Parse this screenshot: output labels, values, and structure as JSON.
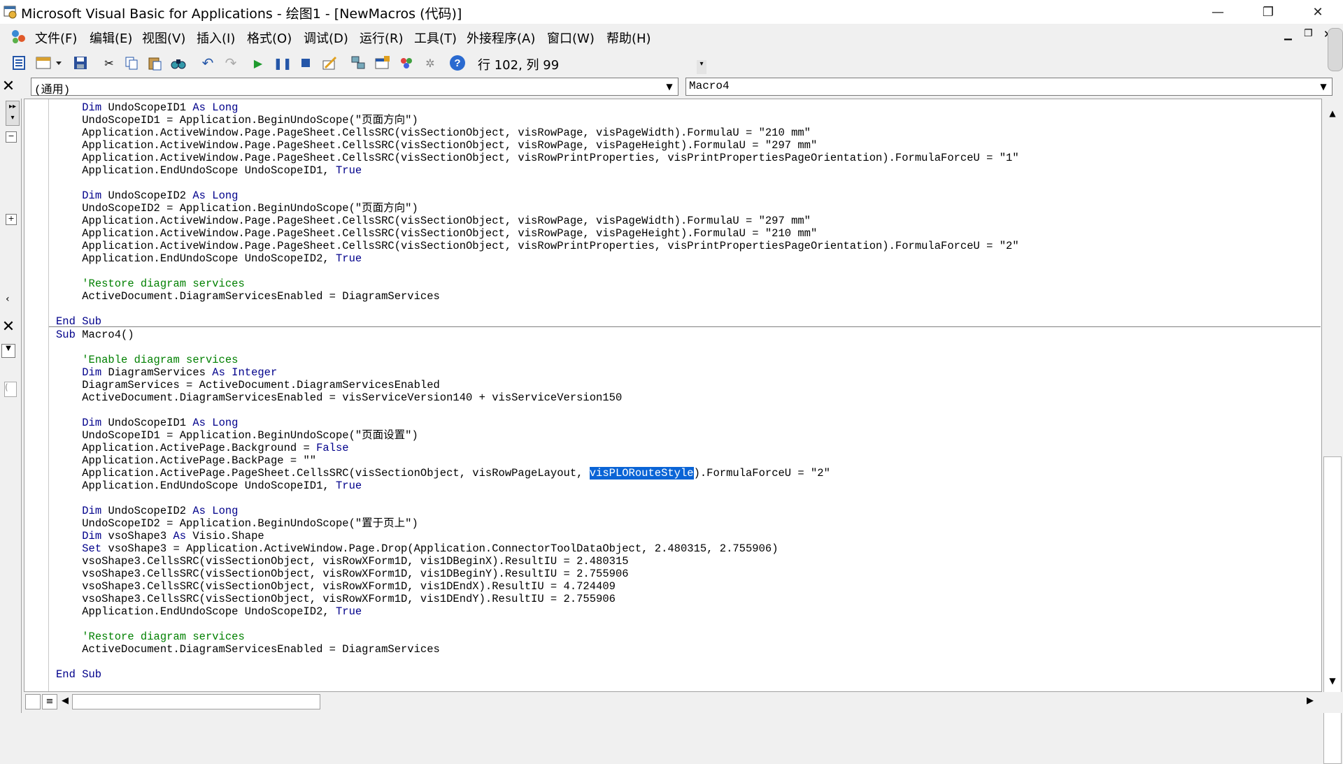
{
  "window": {
    "title": "Microsoft Visual Basic for Applications - 绘图1 - [NewMacros (代码)]"
  },
  "menu": [
    "文件(F)",
    "编辑(E)",
    "视图(V)",
    "插入(I)",
    "格式(O)",
    "调试(D)",
    "运行(R)",
    "工具(T)",
    "外接程序(A)",
    "窗口(W)",
    "帮助(H)"
  ],
  "toolbar": {
    "cursor_position": "行 102, 列 99",
    "icons": [
      "view-object-icon",
      "insert-module-icon",
      "save-icon",
      "cut-icon",
      "copy-icon",
      "paste-icon",
      "find-icon",
      "undo-icon",
      "redo-icon",
      "run-icon",
      "break-icon",
      "reset-icon",
      "design-mode-icon",
      "project-explorer-icon",
      "properties-icon",
      "object-browser-icon",
      "toolbox-icon",
      "help-icon"
    ]
  },
  "object_combo": {
    "value": "(通用)"
  },
  "procedure_combo": {
    "value": "Macro4"
  },
  "code_top": [
    {
      "ind": "    ",
      "parts": [
        {
          "t": "Dim ",
          "c": "kw"
        },
        {
          "t": "UndoScopeID1 "
        },
        {
          "t": "As Long",
          "c": "kw"
        }
      ]
    },
    {
      "ind": "    ",
      "parts": [
        {
          "t": "UndoScopeID1 = Application.BeginUndoScope(\"页面方向\")"
        }
      ]
    },
    {
      "ind": "    ",
      "parts": [
        {
          "t": "Application.ActiveWindow.Page.PageSheet.CellsSRC(visSectionObject, visRowPage, visPageWidth).FormulaU = \"210 mm\""
        }
      ]
    },
    {
      "ind": "    ",
      "parts": [
        {
          "t": "Application.ActiveWindow.Page.PageSheet.CellsSRC(visSectionObject, visRowPage, visPageHeight).FormulaU = \"297 mm\""
        }
      ]
    },
    {
      "ind": "    ",
      "parts": [
        {
          "t": "Application.ActiveWindow.Page.PageSheet.CellsSRC(visSectionObject, visRowPrintProperties, visPrintPropertiesPageOrientation).FormulaForceU = \"1\""
        }
      ]
    },
    {
      "ind": "    ",
      "parts": [
        {
          "t": "Application.EndUndoScope UndoScopeID1, "
        },
        {
          "t": "True",
          "c": "kw"
        }
      ]
    },
    {
      "ind": "",
      "parts": []
    },
    {
      "ind": "    ",
      "parts": [
        {
          "t": "Dim ",
          "c": "kw"
        },
        {
          "t": "UndoScopeID2 "
        },
        {
          "t": "As Long",
          "c": "kw"
        }
      ]
    },
    {
      "ind": "    ",
      "parts": [
        {
          "t": "UndoScopeID2 = Application.BeginUndoScope(\"页面方向\")"
        }
      ]
    },
    {
      "ind": "    ",
      "parts": [
        {
          "t": "Application.ActiveWindow.Page.PageSheet.CellsSRC(visSectionObject, visRowPage, visPageWidth).FormulaU = \"297 mm\""
        }
      ]
    },
    {
      "ind": "    ",
      "parts": [
        {
          "t": "Application.ActiveWindow.Page.PageSheet.CellsSRC(visSectionObject, visRowPage, visPageHeight).FormulaU = \"210 mm\""
        }
      ]
    },
    {
      "ind": "    ",
      "parts": [
        {
          "t": "Application.ActiveWindow.Page.PageSheet.CellsSRC(visSectionObject, visRowPrintProperties, visPrintPropertiesPageOrientation).FormulaForceU = \"2\""
        }
      ]
    },
    {
      "ind": "    ",
      "parts": [
        {
          "t": "Application.EndUndoScope UndoScopeID2, "
        },
        {
          "t": "True",
          "c": "kw"
        }
      ]
    },
    {
      "ind": "",
      "parts": []
    },
    {
      "ind": "    ",
      "parts": [
        {
          "t": "'Restore diagram services",
          "c": "cm"
        }
      ]
    },
    {
      "ind": "    ",
      "parts": [
        {
          "t": "ActiveDocument.DiagramServicesEnabled = DiagramServices"
        }
      ]
    },
    {
      "ind": "",
      "parts": []
    },
    {
      "ind": "",
      "parts": [
        {
          "t": "End Sub",
          "c": "kw"
        }
      ]
    }
  ],
  "code_bottom": [
    {
      "ind": "",
      "parts": [
        {
          "t": "Sub ",
          "c": "kw"
        },
        {
          "t": "Macro4()"
        }
      ]
    },
    {
      "ind": "",
      "parts": []
    },
    {
      "ind": "    ",
      "parts": [
        {
          "t": "'Enable diagram services",
          "c": "cm"
        }
      ]
    },
    {
      "ind": "    ",
      "parts": [
        {
          "t": "Dim ",
          "c": "kw"
        },
        {
          "t": "DiagramServices "
        },
        {
          "t": "As Integer",
          "c": "kw"
        }
      ]
    },
    {
      "ind": "    ",
      "parts": [
        {
          "t": "DiagramServices = ActiveDocument.DiagramServicesEnabled"
        }
      ]
    },
    {
      "ind": "    ",
      "parts": [
        {
          "t": "ActiveDocument.DiagramServicesEnabled = visServiceVersion140 + visServiceVersion150"
        }
      ]
    },
    {
      "ind": "",
      "parts": []
    },
    {
      "ind": "    ",
      "parts": [
        {
          "t": "Dim ",
          "c": "kw"
        },
        {
          "t": "UndoScopeID1 "
        },
        {
          "t": "As Long",
          "c": "kw"
        }
      ]
    },
    {
      "ind": "    ",
      "parts": [
        {
          "t": "UndoScopeID1 = Application.BeginUndoScope(\"页面设置\")"
        }
      ]
    },
    {
      "ind": "    ",
      "parts": [
        {
          "t": "Application.ActivePage.Background = "
        },
        {
          "t": "False",
          "c": "kw"
        }
      ]
    },
    {
      "ind": "    ",
      "parts": [
        {
          "t": "Application.ActivePage.BackPage = \"\""
        }
      ]
    },
    {
      "ind": "    ",
      "parts": [
        {
          "t": "Application.ActivePage.PageSheet.CellsSRC(visSectionObject, visRowPageLayout, "
        },
        {
          "t": "visPLORouteStyle",
          "c": "sel"
        },
        {
          "t": ").FormulaForceU = \"2\""
        }
      ]
    },
    {
      "ind": "    ",
      "parts": [
        {
          "t": "Application.EndUndoScope UndoScopeID1, "
        },
        {
          "t": "True",
          "c": "kw"
        }
      ]
    },
    {
      "ind": "",
      "parts": []
    },
    {
      "ind": "    ",
      "parts": [
        {
          "t": "Dim ",
          "c": "kw"
        },
        {
          "t": "UndoScopeID2 "
        },
        {
          "t": "As Long",
          "c": "kw"
        }
      ]
    },
    {
      "ind": "    ",
      "parts": [
        {
          "t": "UndoScopeID2 = Application.BeginUndoScope(\"置于页上\")"
        }
      ]
    },
    {
      "ind": "    ",
      "parts": [
        {
          "t": "Dim ",
          "c": "kw"
        },
        {
          "t": "vsoShape3 "
        },
        {
          "t": "As ",
          "c": "kw"
        },
        {
          "t": "Visio.Shape"
        }
      ]
    },
    {
      "ind": "    ",
      "parts": [
        {
          "t": "Set ",
          "c": "kw"
        },
        {
          "t": "vsoShape3 = Application.ActiveWindow.Page.Drop(Application.ConnectorToolDataObject, 2.480315, 2.755906)"
        }
      ]
    },
    {
      "ind": "    ",
      "parts": [
        {
          "t": "vsoShape3.CellsSRC(visSectionObject, visRowXForm1D, vis1DBeginX).ResultIU = 2.480315"
        }
      ]
    },
    {
      "ind": "    ",
      "parts": [
        {
          "t": "vsoShape3.CellsSRC(visSectionObject, visRowXForm1D, vis1DBeginY).ResultIU = 2.755906"
        }
      ]
    },
    {
      "ind": "    ",
      "parts": [
        {
          "t": "vsoShape3.CellsSRC(visSectionObject, visRowXForm1D, vis1DEndX).ResultIU = 4.724409"
        }
      ]
    },
    {
      "ind": "    ",
      "parts": [
        {
          "t": "vsoShape3.CellsSRC(visSectionObject, visRowXForm1D, vis1DEndY).ResultIU = 2.755906"
        }
      ]
    },
    {
      "ind": "    ",
      "parts": [
        {
          "t": "Application.EndUndoScope UndoScopeID2, "
        },
        {
          "t": "True",
          "c": "kw"
        }
      ]
    },
    {
      "ind": "",
      "parts": []
    },
    {
      "ind": "    ",
      "parts": [
        {
          "t": "'Restore diagram services",
          "c": "cm"
        }
      ]
    },
    {
      "ind": "    ",
      "parts": [
        {
          "t": "ActiveDocument.DiagramServicesEnabled = DiagramServices"
        }
      ]
    },
    {
      "ind": "",
      "parts": []
    },
    {
      "ind": "",
      "parts": [
        {
          "t": "End Sub",
          "c": "kw"
        }
      ]
    }
  ]
}
